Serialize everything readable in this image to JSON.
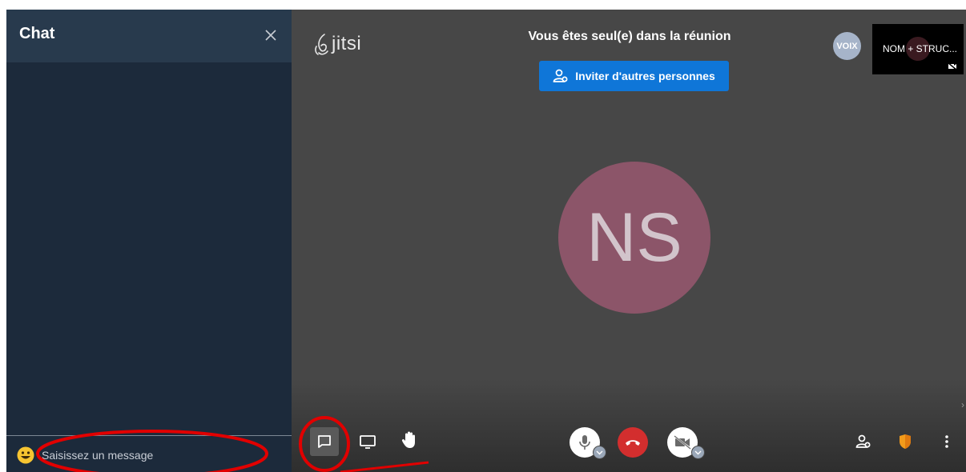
{
  "chat": {
    "title": "Chat",
    "input_placeholder": "Saisissez un message"
  },
  "stage": {
    "logo_text": "jitsi",
    "alone_title": "Vous êtes seul(e) dans la réunion",
    "invite_label": "Inviter d'autres personnes",
    "main_avatar_initials": "NS",
    "voix_avatar_label": "VOIX",
    "thumbnail_name": "NOM + STRUC..."
  },
  "icons": {
    "close": "close-icon",
    "emoji": "smiley-emoji-icon",
    "chat": "chat-bubble-icon",
    "screen_share": "monitor-icon",
    "raise_hand": "hand-icon",
    "mic": "microphone-icon",
    "hangup": "phone-hangup-icon",
    "camera": "camera-off-icon",
    "invite": "add-person-icon",
    "security": "shield-icon",
    "more": "more-vertical-icon"
  },
  "colors": {
    "chat_bg": "#1c2a3b",
    "chat_header_bg": "#283a4d",
    "stage_bg": "#474747",
    "invite_button": "#0f76d8",
    "avatar_bg": "#8c5569",
    "hangup_bg": "#d32e2e",
    "shield": "#f29b1b",
    "annotation": "#e10000"
  }
}
